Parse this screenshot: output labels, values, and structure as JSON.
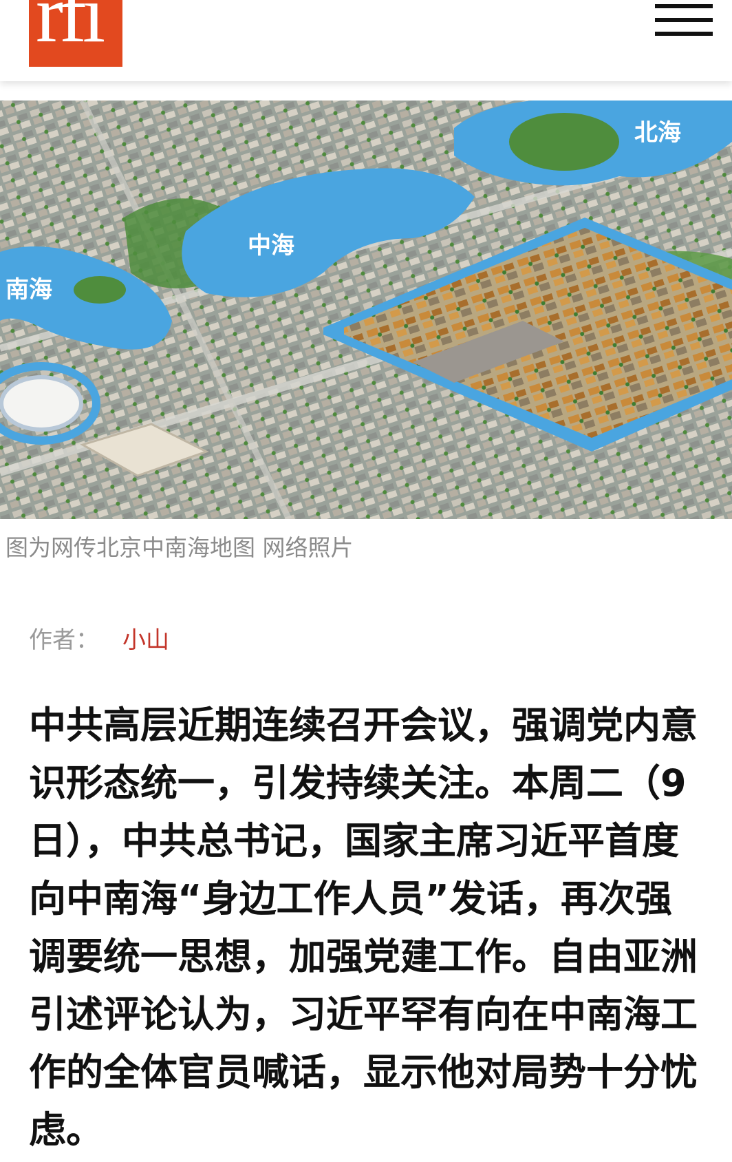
{
  "header": {
    "logo_text": "rfi",
    "logo_color": "#e2491f",
    "menu_icon": "hamburger-menu-icon"
  },
  "hero": {
    "map_labels": {
      "beihai": "北海",
      "zhonghai": "中海",
      "nanhai": "南海"
    },
    "water_color": "#4aa5e0"
  },
  "caption": "图为网传北京中南海地图 网络照片",
  "author": {
    "label": "作者：",
    "name": "小山",
    "name_color": "#c3352a"
  },
  "lead": "中共高层近期连续召开会议，强调党内意识形态统一，引发持续关注。本周二（9日），中共总书记，国家主席习近平首度向中南海“身边工作人员”发话，再次强调要统一思想，加强党建工作。自由亚洲引述评论认为，习近平罕有向在中南海工作的全体官员喊话，显示他对局势十分忧虑。"
}
